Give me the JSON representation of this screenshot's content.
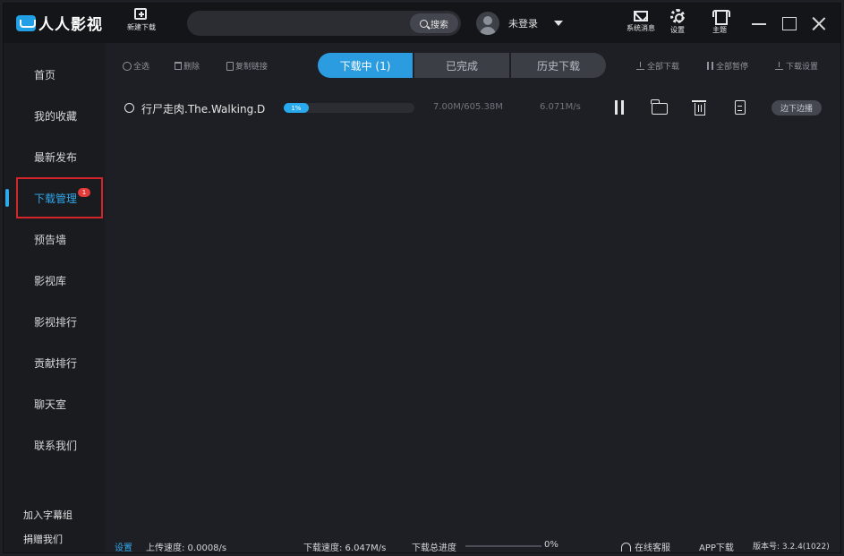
{
  "app": {
    "logo_text": "人人影视"
  },
  "header": {
    "new_download_label": "新建下载",
    "search_placeholder": "",
    "search_button": "搜索",
    "user_name": "未登录",
    "system_message_label": "系统消息",
    "settings_label": "设置",
    "theme_label": "主题"
  },
  "sidebar": {
    "items": [
      {
        "label": "首页"
      },
      {
        "label": "我的收藏"
      },
      {
        "label": "最新发布"
      },
      {
        "label": "下载管理"
      },
      {
        "label": "预告墙"
      },
      {
        "label": "影视库"
      },
      {
        "label": "影视排行"
      },
      {
        "label": "贡献排行"
      },
      {
        "label": "聊天室"
      },
      {
        "label": "联系我们"
      }
    ],
    "active_index": 3,
    "active_badge": "1",
    "footer": [
      "加入字幕组",
      "捐赠我们"
    ]
  },
  "toolbar": {
    "select_all": "全选",
    "delete": "删除",
    "copy_link": "复制链接",
    "tabs": [
      "下载中 (1)",
      "已完成",
      "历史下载"
    ],
    "active_tab": 0,
    "download_all": "全部下载",
    "pause_all": "全部暂停",
    "download_settings": "下载设置"
  },
  "downloads": [
    {
      "name": "行尸走肉.The.Walking.D",
      "progress_label": "1%",
      "progress": 0.01,
      "size": "7.00M/605.38M",
      "speed": "6.071M/s",
      "play_label": "边下边播"
    }
  ],
  "statusbar": {
    "settings": "设置",
    "upload_speed": "上传速度:  0.0008/s",
    "download_speed": "下载速度:  6.047M/s",
    "total_progress_label": "下载总进度",
    "total_progress": "0%",
    "online_service": "在线客服",
    "app_download": "APP下载",
    "version": "版本号: 3.2.4(1022)"
  },
  "colors": {
    "accent": "#2b9ce0",
    "highlight_box": "#d3252a",
    "background": "#1e1f24"
  }
}
